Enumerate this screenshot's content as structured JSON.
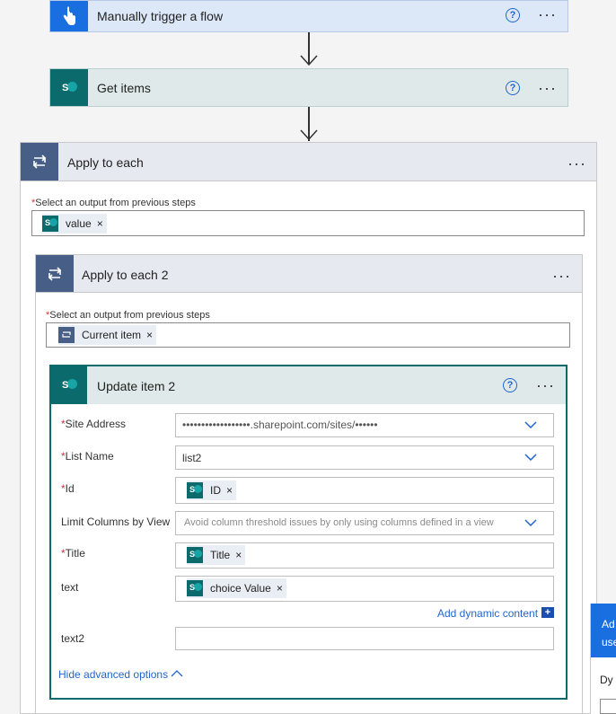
{
  "steps": {
    "trigger": {
      "title": "Manually trigger a flow"
    },
    "get_items": {
      "title": "Get items"
    },
    "apply_each": {
      "title": "Apply to each",
      "output_label": "Select an output from previous steps",
      "token": "value"
    },
    "apply_each_2": {
      "title": "Apply to each 2",
      "output_label": "Select an output from previous steps",
      "token": "Current item"
    },
    "update_item": {
      "title": "Update item 2",
      "fields": {
        "site_address": {
          "label": "Site Address",
          "value": "••••••••••••••••••.sharepoint.com/sites/••••••"
        },
        "list_name": {
          "label": "List Name",
          "value": "list2"
        },
        "id": {
          "label": "Id",
          "token": "ID"
        },
        "limit_columns": {
          "label": "Limit Columns by View",
          "placeholder": "Avoid column threshold issues by only using columns defined in a view"
        },
        "title": {
          "label": "Title",
          "token": "Title"
        },
        "text": {
          "label": "text",
          "token": "choice Value"
        },
        "text2": {
          "label": "text2",
          "value": ""
        }
      },
      "add_dynamic": "Add dynamic content",
      "hide_advanced": "Hide advanced options"
    }
  },
  "side_panel": {
    "line1": "Ad",
    "line2": "use",
    "line3": "Dy"
  },
  "colors": {
    "trigger_head": "#dce8f8",
    "sp_head": "#dfe9e9",
    "loop_head": "#e6e9f0",
    "accent": "#2266cc",
    "sharepoint": "#0b6a6b",
    "loop": "#475f86"
  }
}
